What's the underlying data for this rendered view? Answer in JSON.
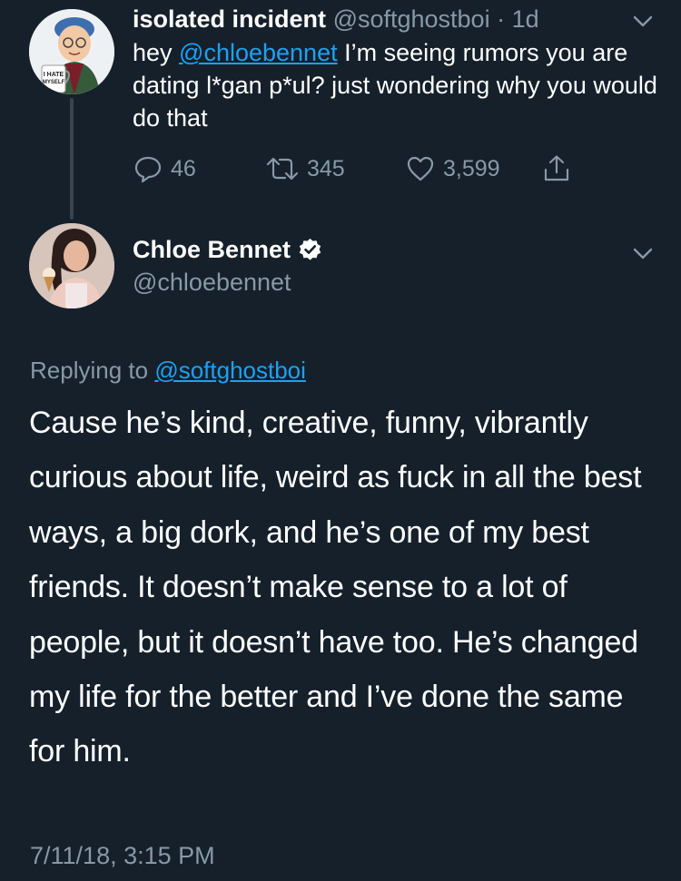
{
  "tweet1": {
    "author_name": "isolated incident",
    "author_handle": "@softghostboi",
    "separator": "·",
    "time": "1d",
    "text_prefix": "hey ",
    "mention": "@chloebennet",
    "text_suffix": " I’m seeing rumors you are dating l*gan p*ul? just wondering why you would do that",
    "avatar_mug_text": "I HATE MYSELF",
    "replies": "46",
    "retweets": "345",
    "likes": "3,599",
    "icons": [
      "reply-icon",
      "retweet-icon",
      "like-icon",
      "share-icon",
      "chevron-down-icon"
    ]
  },
  "tweet2": {
    "author_name": "Chloe Bennet",
    "author_handle": "@chloebennet",
    "verified": true,
    "replying_prefix": "Replying to ",
    "replying_to": "@softghostboi",
    "text": "Cause he’s kind, creative, funny, vibrantly curious about life, weird as fuck in all the best ways, a big dork, and he’s one of my best friends. It doesn’t make sense to a lot of people, but it doesn’t have too. He’s changed my life for the better and I’ve done the same for him.",
    "timestamp": "7/11/18, 3:15 PM"
  },
  "colors": {
    "background": "#15202b",
    "text": "#ffffff",
    "muted": "#8899a6",
    "link": "#1da1f2",
    "thread_line": "#38444d"
  }
}
